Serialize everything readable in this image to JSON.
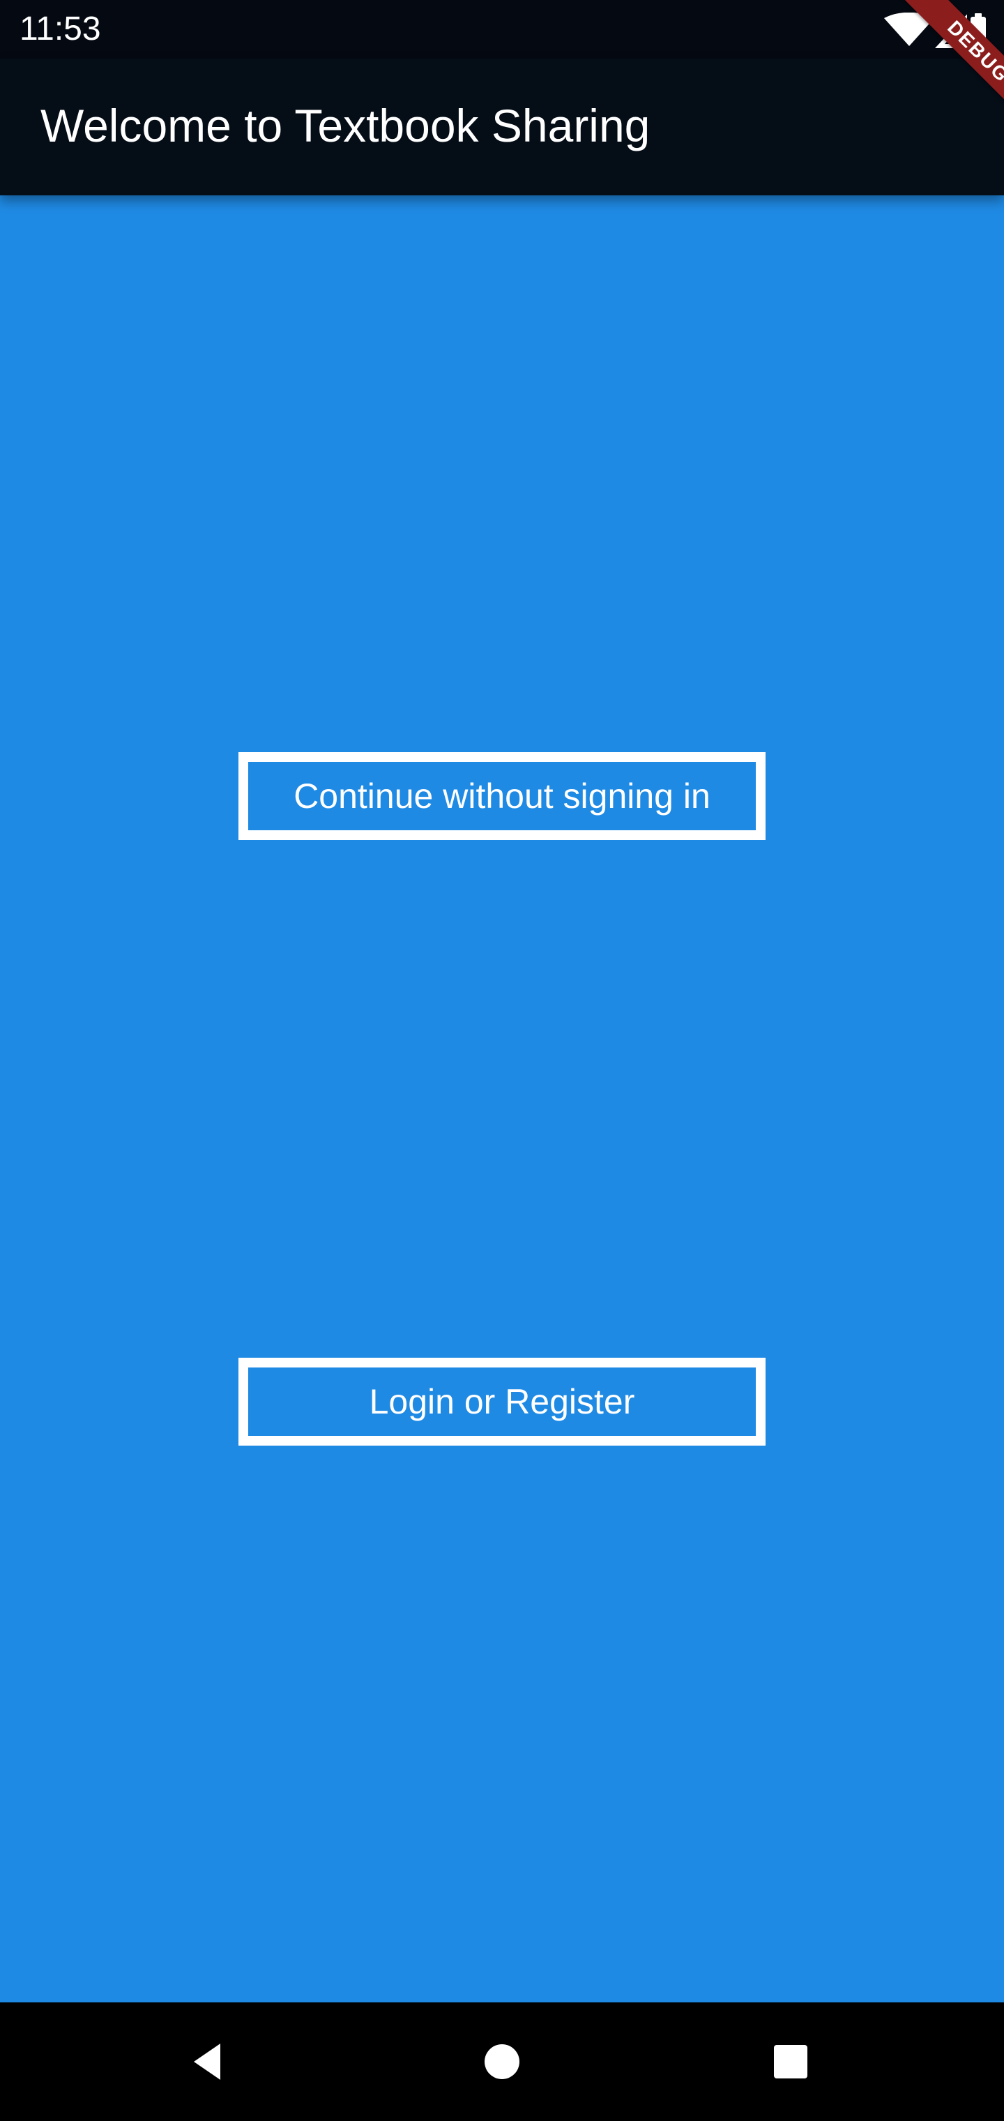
{
  "status_bar": {
    "time": "11:53",
    "icons": [
      "wifi-icon",
      "cellular-signal-icon",
      "battery-icon"
    ],
    "background": "#050a12"
  },
  "debug_banner": {
    "label": "DEBUG",
    "color": "#8c1d1d"
  },
  "app_bar": {
    "title": "Welcome to Textbook Sharing",
    "background": "#050d17",
    "text_color": "#ffffff"
  },
  "main": {
    "background": "#1f8ae4",
    "buttons": [
      {
        "label": "Continue without signing in",
        "border_color": "#ffffff"
      },
      {
        "label": "Login or Register",
        "border_color": "#ffffff"
      }
    ]
  },
  "navigation_bar": {
    "items": [
      "back-icon",
      "home-icon",
      "recent-apps-icon"
    ],
    "background": "#000000",
    "icon_color": "#ffffff"
  }
}
